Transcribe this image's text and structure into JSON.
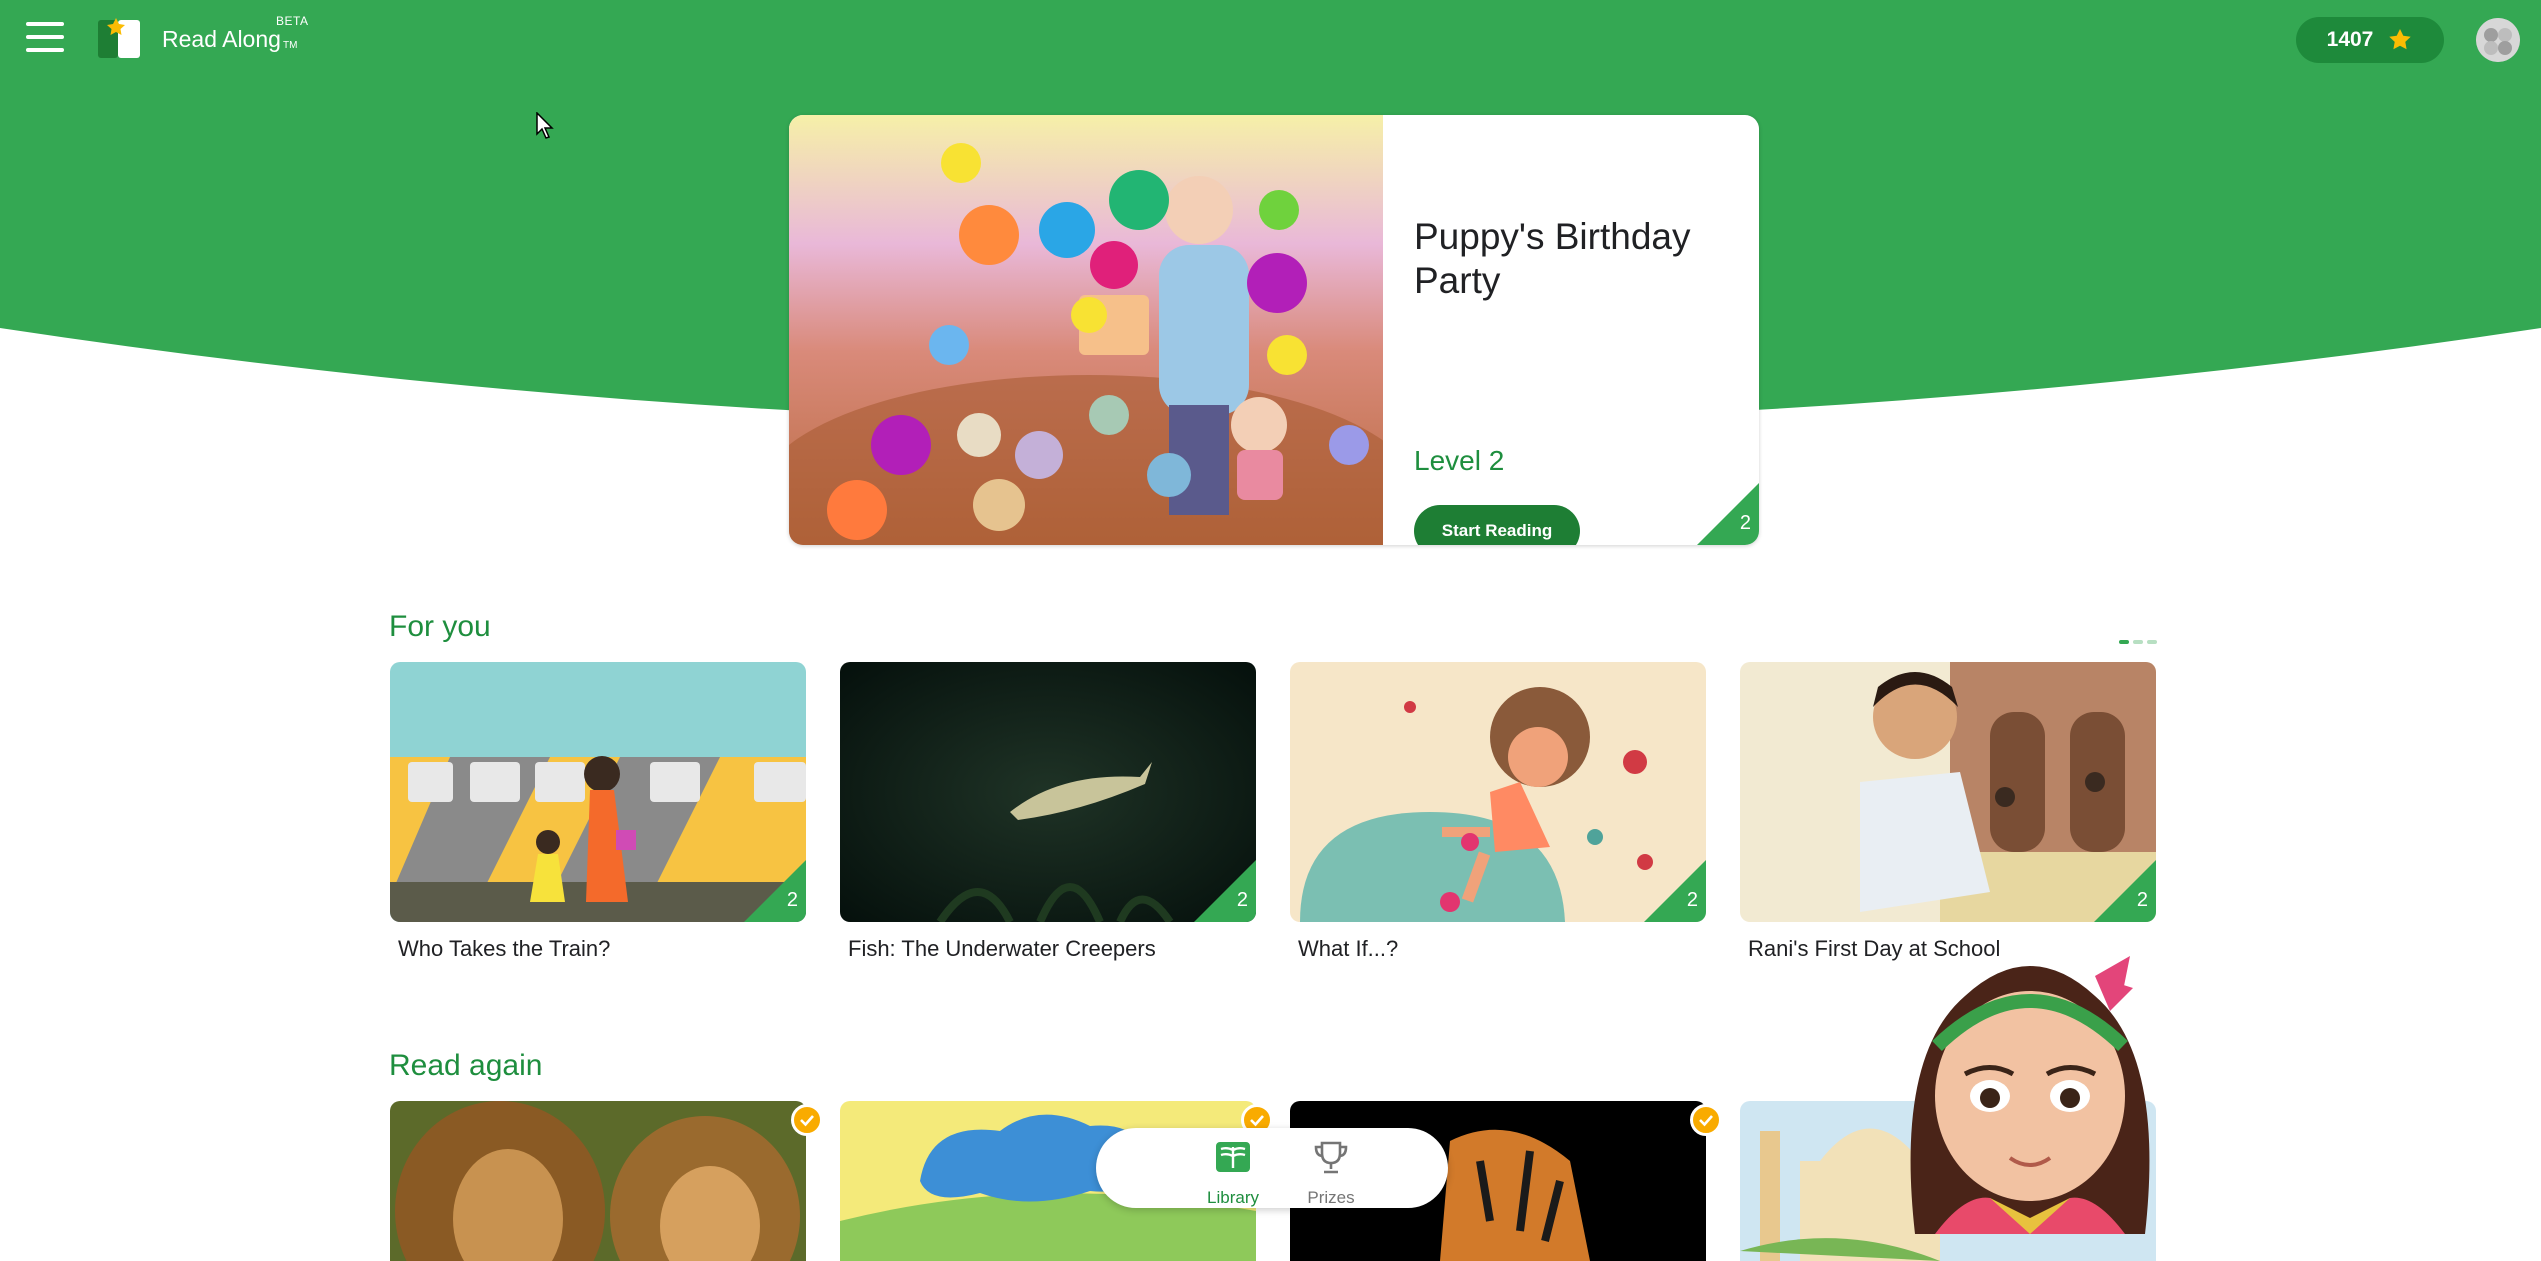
{
  "app": {
    "title": "Read Along",
    "trademark": "TM",
    "beta_badge": "BETA"
  },
  "header": {
    "stars_count": "1407",
    "stars_icon": "star-icon",
    "menu_icon": "hamburger-menu-icon",
    "avatar_icon": "profile-avatar-icon"
  },
  "featured": {
    "title": "Puppy's Birthday Party",
    "level": "Level 2",
    "start_button": "Start Reading",
    "level_badge": "2"
  },
  "for_you": {
    "heading": "For you",
    "books": [
      {
        "title": "Who Takes the Train?",
        "level": "2"
      },
      {
        "title": "Fish: The Underwater Creepers",
        "level": "2"
      },
      {
        "title": "What If...?",
        "level": "2"
      },
      {
        "title": "Rani's First Day at School",
        "level": "2"
      }
    ]
  },
  "read_again": {
    "heading": "Read again",
    "completed_icon": "checkmark-icon"
  },
  "bottom_nav": {
    "library_label": "Library",
    "prizes_label": "Prizes",
    "active": "Library"
  },
  "colors": {
    "brand_green": "#34a853",
    "dark_green": "#1e7e34",
    "text_green": "#1e8e3e",
    "badge_orange": "#f9ab00"
  }
}
